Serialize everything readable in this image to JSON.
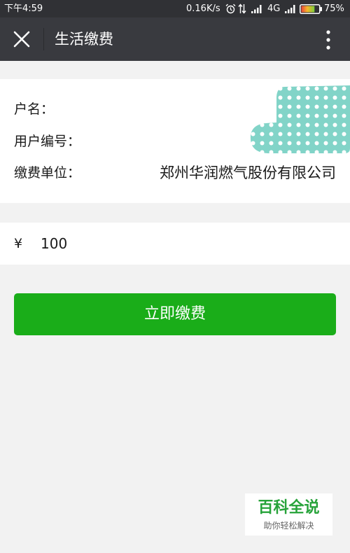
{
  "status_bar": {
    "time": "下午4:59",
    "net_speed": "0.16K/s",
    "network_type": "4G",
    "battery": "75%",
    "icons": [
      "alarm-icon",
      "data-activity-icon",
      "signal-icon",
      "signal-icon",
      "battery-icon"
    ]
  },
  "header": {
    "title": "生活缴费",
    "left_icon": "close-icon",
    "right_icon": "more-vertical-icon"
  },
  "bill_info": {
    "rows": [
      {
        "label": "户名："
      },
      {
        "label": "用户编号："
      },
      {
        "label": "缴费单位：",
        "value": "郑州华润燃气股份有限公司"
      }
    ]
  },
  "amount": {
    "currency": "¥",
    "value": "100"
  },
  "pay_button": {
    "label": "立即缴费"
  },
  "watermark": {
    "brand": "百科全说",
    "slogan": "助你轻松解决"
  },
  "colors": {
    "header": "#393a3f",
    "page_background": "#f2f2f2",
    "button": "#1aad19",
    "redaction": "#82d4c8",
    "watermark_brand": "#27a33a"
  }
}
